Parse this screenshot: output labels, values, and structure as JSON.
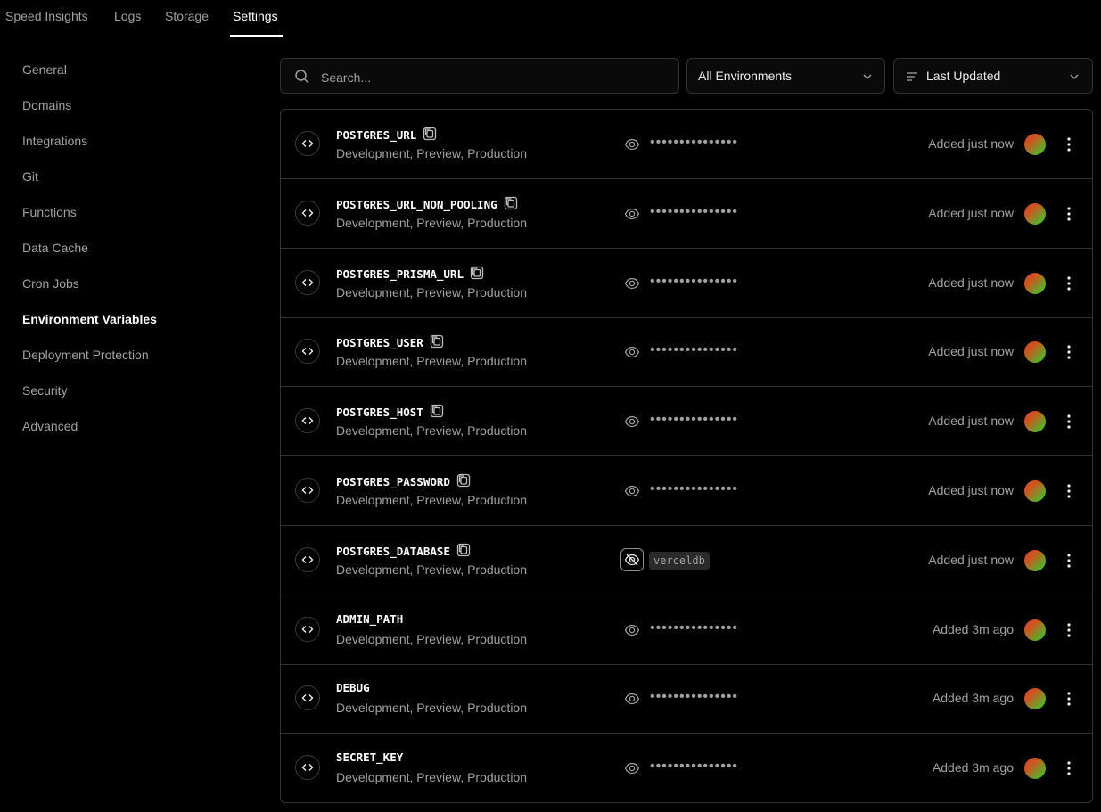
{
  "top_tabs": [
    {
      "label": "Speed Insights"
    },
    {
      "label": "Logs"
    },
    {
      "label": "Storage"
    },
    {
      "label": "Settings",
      "active": true
    }
  ],
  "sidebar": {
    "items": [
      {
        "label": "General"
      },
      {
        "label": "Domains"
      },
      {
        "label": "Integrations"
      },
      {
        "label": "Git"
      },
      {
        "label": "Functions"
      },
      {
        "label": "Data Cache"
      },
      {
        "label": "Cron Jobs"
      },
      {
        "label": "Environment Variables",
        "active": true
      },
      {
        "label": "Deployment Protection"
      },
      {
        "label": "Security"
      },
      {
        "label": "Advanced"
      }
    ]
  },
  "toolbar": {
    "search_placeholder": "Search...",
    "environment_filter": "All Environments",
    "sort": "Last Updated"
  },
  "env_vars": [
    {
      "name": "POSTGRES_URL",
      "copy_icon": true,
      "environments": "Development, Preview, Production",
      "value_display": "•••••••••••••••",
      "revealed": false,
      "added": "Added just now"
    },
    {
      "name": "POSTGRES_URL_NON_POOLING",
      "copy_icon": true,
      "environments": "Development, Preview, Production",
      "value_display": "•••••••••••••••",
      "revealed": false,
      "added": "Added just now"
    },
    {
      "name": "POSTGRES_PRISMA_URL",
      "copy_icon": true,
      "environments": "Development, Preview, Production",
      "value_display": "•••••••••••••••",
      "revealed": false,
      "added": "Added just now"
    },
    {
      "name": "POSTGRES_USER",
      "copy_icon": true,
      "environments": "Development, Preview, Production",
      "value_display": "•••••••••••••••",
      "revealed": false,
      "added": "Added just now"
    },
    {
      "name": "POSTGRES_HOST",
      "copy_icon": true,
      "environments": "Development, Preview, Production",
      "value_display": "•••••••••••••••",
      "revealed": false,
      "added": "Added just now"
    },
    {
      "name": "POSTGRES_PASSWORD",
      "copy_icon": true,
      "environments": "Development, Preview, Production",
      "value_display": "•••••••••••••••",
      "revealed": false,
      "added": "Added just now"
    },
    {
      "name": "POSTGRES_DATABASE",
      "copy_icon": true,
      "environments": "Development, Preview, Production",
      "value_display": "verceldb",
      "revealed": true,
      "added": "Added just now"
    },
    {
      "name": "ADMIN_PATH",
      "copy_icon": false,
      "environments": "Development, Preview, Production",
      "value_display": "•••••••••••••••",
      "revealed": false,
      "added": "Added 3m ago"
    },
    {
      "name": "DEBUG",
      "copy_icon": false,
      "environments": "Development, Preview, Production",
      "value_display": "•••••••••••••••",
      "revealed": false,
      "added": "Added 3m ago"
    },
    {
      "name": "SECRET_KEY",
      "copy_icon": false,
      "environments": "Development, Preview, Production",
      "value_display": "•••••••••••••••",
      "revealed": false,
      "added": "Added 3m ago"
    }
  ]
}
